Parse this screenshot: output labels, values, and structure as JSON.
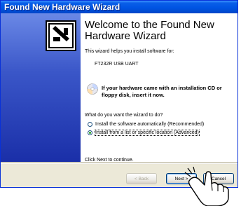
{
  "window": {
    "title": "Found New Hardware Wizard"
  },
  "main": {
    "heading": "Welcome to the Found New Hardware Wizard",
    "intro": "This wizard helps you install software for:",
    "device": "FT232R USB UART",
    "cd_prompt": "If your hardware came with an installation CD or floppy disk, insert it now.",
    "question": "What do you want the wizard to do?",
    "options": [
      {
        "label": "Install the software automatically (Recommended)",
        "selected": false
      },
      {
        "label": "Install from a list or specific location (Advanced)",
        "selected": true
      }
    ],
    "continue_text": "Click Next to continue."
  },
  "buttons": {
    "back": "< Back",
    "next": "Next >",
    "cancel": "Cancel"
  },
  "icons": [
    "wizard-hardware-icon",
    "cd-icon",
    "pointing-hand-icon"
  ],
  "colors": {
    "titlebar": "#0054e3",
    "side_panel": "#3a56c8",
    "dialog_bg": "#ece9d8"
  }
}
